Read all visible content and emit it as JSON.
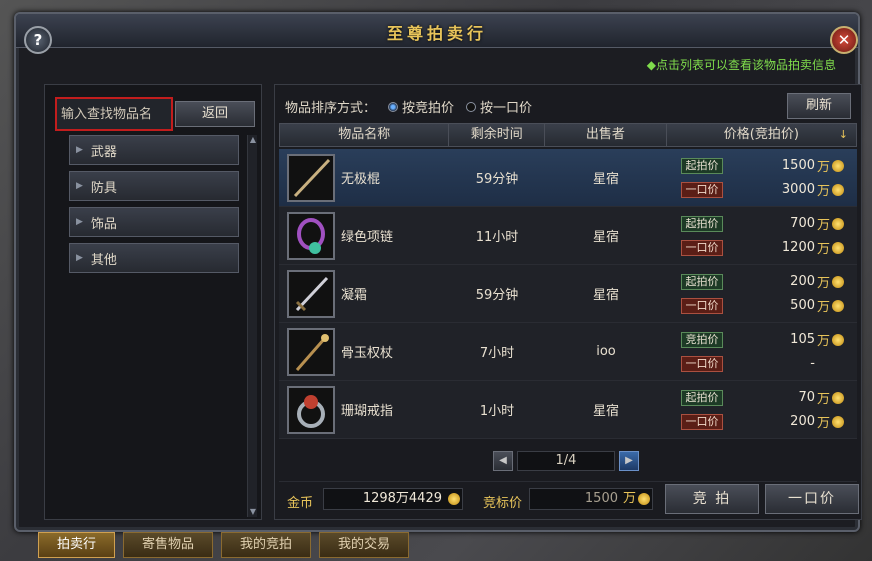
{
  "window": {
    "title": "至尊拍卖行",
    "hint": "点击列表可以查看该物品拍卖信息"
  },
  "left": {
    "search_placeholder": "输入查找物品名",
    "back_label": "返回",
    "categories": [
      {
        "label": "武器"
      },
      {
        "label": "防具"
      },
      {
        "label": "饰品"
      },
      {
        "label": "其他"
      }
    ]
  },
  "sort": {
    "label": "物品排序方式：",
    "option_bid": "按竞拍价",
    "option_buyout": "按一口价",
    "selected": "按竞拍价",
    "refresh_label": "刷新"
  },
  "table": {
    "headers": {
      "name": "物品名称",
      "time": "剩余时间",
      "seller": "出售者",
      "price": "价格(竞拍价)"
    },
    "rows": [
      {
        "name": "无极棍",
        "time": "59分钟",
        "seller": "星宿",
        "tag1": "起拍价",
        "price1": "1500",
        "tag2": "一口价",
        "price2": "3000",
        "selected": true
      },
      {
        "name": "绿色项链",
        "time": "11小时",
        "seller": "星宿",
        "tag1": "起拍价",
        "price1": "700",
        "tag2": "一口价",
        "price2": "1200"
      },
      {
        "name": "凝霜",
        "time": "59分钟",
        "seller": "星宿",
        "tag1": "起拍价",
        "price1": "200",
        "tag2": "一口价",
        "price2": "500"
      },
      {
        "name": "骨玉权杖",
        "time": "7小时",
        "seller": "ioo",
        "tag1": "竞拍价",
        "price1": "105",
        "tag2": "一口价",
        "price2": "-"
      },
      {
        "name": "珊瑚戒指",
        "time": "1小时",
        "seller": "星宿",
        "tag1": "起拍价",
        "price1": "70",
        "tag2": "一口价",
        "price2": "200"
      }
    ],
    "unit": "万"
  },
  "pager": {
    "page": "1/4"
  },
  "bottom": {
    "gold_label": "金币",
    "gold_value": "1298万4429",
    "bid_label": "竞标价",
    "bid_value": "1500",
    "bid_unit": "万",
    "bid_button": "竞 拍",
    "buyout_button": "一口价"
  },
  "tabs": [
    {
      "label": "拍卖行",
      "active": true
    },
    {
      "label": "寄售物品"
    },
    {
      "label": "我的竞拍"
    },
    {
      "label": "我的交易"
    }
  ],
  "colors": {
    "accent_gold": "#e8c45a",
    "hint_green": "#7fdc4c",
    "selected_row": "#2a3e5a",
    "search_outline": "#c21d1d"
  }
}
